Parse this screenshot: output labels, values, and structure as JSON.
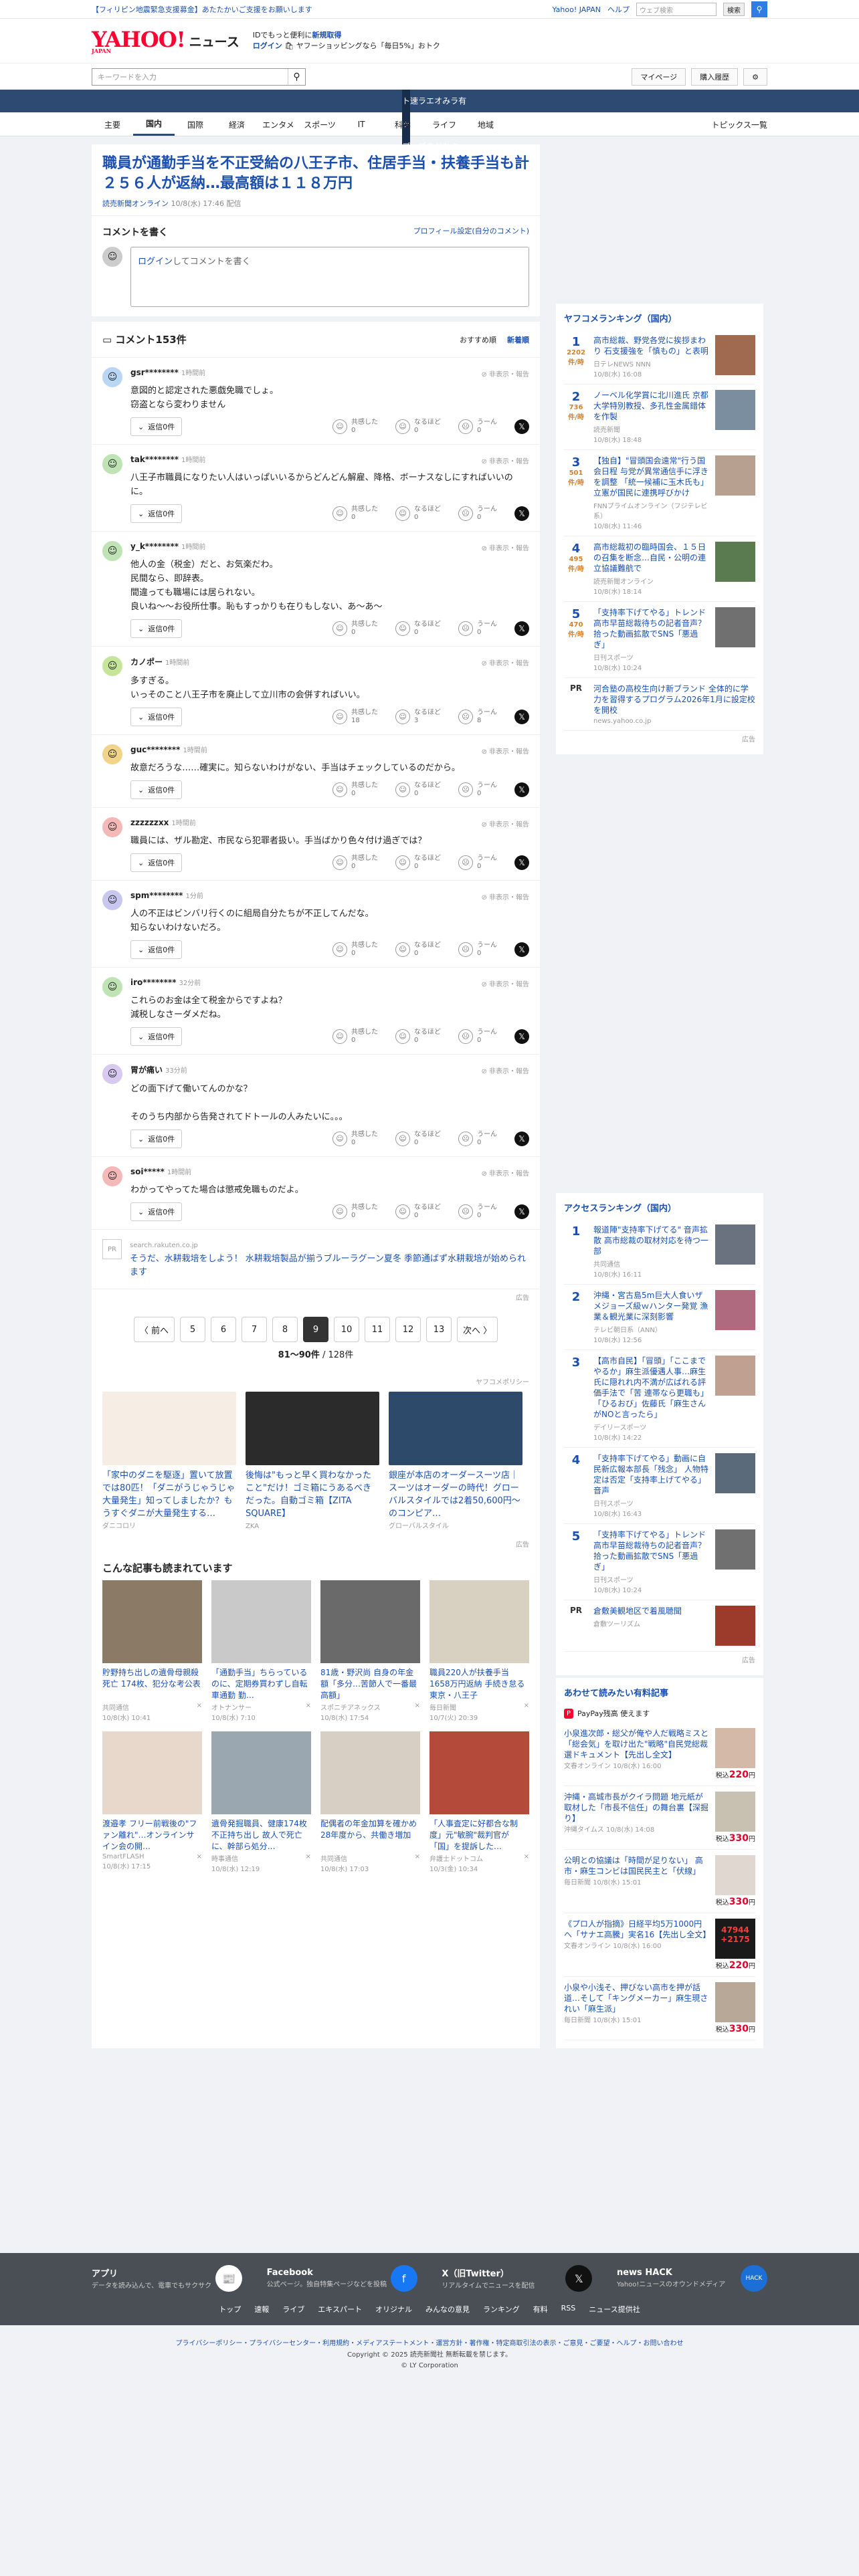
{
  "top_bar": {
    "notice": "【フィリピン地震緊急支援募金】あたたかいご支援をお願いします",
    "yahoo_japan": "Yahoo! JAPAN",
    "help": "ヘルプ",
    "search_placeholder": "ウェブ検索",
    "search_button": "検索"
  },
  "header": {
    "logo": "YAHOO!",
    "logo_sub": "JAPAN",
    "logo_news": "ニュース",
    "promo1": "IDでもっと便利に",
    "promo1_link": "新規取得",
    "promo2_link": "ログイン",
    "promo2": "ヤフーショッピングなら「毎日5%」おトク",
    "search_placeholder": "キーワードを入力",
    "mypage": "マイページ",
    "history": "購入履歴"
  },
  "global_nav": [
    "トップ",
    "速報",
    "ライブ",
    "エキスパート",
    "オリジナル",
    "みんなの意見",
    "ランキング",
    "有料"
  ],
  "sub_nav": [
    "主要",
    "国内",
    "国際",
    "経済",
    "エンタメ",
    "スポーツ",
    "IT",
    "科学",
    "ライフ",
    "地域"
  ],
  "sub_nav_topics": "トピックス一覧",
  "article": {
    "title": "職員が通勤手当を不正受給の八王子市、住居手当・扶養手当も計２５６人が返納…最高額は１１８万円",
    "source": "読売新聞オンライン",
    "date": "10/8(水) 17:46 配信"
  },
  "comment_write": {
    "title": "コメントを書く",
    "profile_link": "プロフィール設定(自分のコメント)",
    "login": "ログイン",
    "placeholder": "してコメントを書く"
  },
  "comments_header": {
    "title": "コメント153件",
    "sort_recommended": "おすすめ順",
    "sort_newest": "新着順"
  },
  "comments": [
    {
      "user": "gsr********",
      "time": "1時間前",
      "text": "意図的と認定された悪戯免職でしょ。\n窃盗となら変わりません",
      "reply": "返信0件",
      "agree": "0",
      "nice": "0",
      "hmm": "0"
    },
    {
      "user": "tak********",
      "time": "1時間前",
      "text": "八王子市職員になりたい人はいっぱいいるからどんどん解雇、降格、ボーナスなしにすればいいのに。",
      "reply": "返信0件",
      "agree": "0",
      "nice": "0",
      "hmm": "0"
    },
    {
      "user": "y_k********",
      "time": "1時間前",
      "text": "他人の金（税金）だと、お気楽だわ。\n民間なら、即辞表。\n間違っても職場には居られない。\n良いね〜〜お役所仕事。恥もすっかりも在りもしない、あ〜あ〜",
      "reply": "返信0件",
      "agree": "0",
      "nice": "0",
      "hmm": "0"
    },
    {
      "user": "カノポー",
      "time": "1時間前",
      "text": "多すぎる。\nいっそのこと八王子市を廃止して立川市の会併すればいい。",
      "reply": "返信0件",
      "agree": "18",
      "nice": "3",
      "hmm": "8"
    },
    {
      "user": "guc********",
      "time": "1時間前",
      "text": "故意だろうな……確実に。知らないわけがない、手当はチェックしているのだから。",
      "reply": "返信0件",
      "agree": "0",
      "nice": "0",
      "hmm": "0"
    },
    {
      "user": "zzzzzzxx",
      "time": "1時間前",
      "text": "職員には、ザル勘定、市民なら犯罪者扱い。手当ばかり色々付け過ぎでは？",
      "reply": "返信0件",
      "agree": "0",
      "nice": "0",
      "hmm": "0"
    },
    {
      "user": "spm********",
      "time": "1分前",
      "text": "人の不正はビンバリ行くのに組局自分たちが不正してんだな。\n知らないわけないだろ。",
      "reply": "返信0件",
      "agree": "0",
      "nice": "0",
      "hmm": "0"
    },
    {
      "user": "iro********",
      "time": "32分前",
      "text": "これらのお金は全て税金からですよね？\n減税しなさーダメだね。",
      "reply": "返信0件",
      "agree": "0",
      "nice": "0",
      "hmm": "0"
    },
    {
      "user": "胃が痛い",
      "time": "33分前",
      "text": "どの面下げて働いてんのかな？\n\nそのうち内部から告発されてドトールの人みたいに。。。",
      "reply": "返信0件",
      "agree": "0",
      "nice": "0",
      "hmm": "0"
    },
    {
      "user": "soi*****",
      "time": "1時間前",
      "text": "わかってやってた場合は懲戒免職ものだよ。",
      "reply": "返信0件",
      "agree": "0",
      "nice": "0",
      "hmm": "0"
    }
  ],
  "hide_report": "非表示・報告",
  "vote_labels": {
    "agree": "共感した",
    "nice": "なるほど",
    "hmm": "うーん"
  },
  "pr_ad": {
    "source": "search.rakuten.co.jp",
    "text": "そうだ、水耕栽培をしよう！ 水耕栽培製品が揃うブルーラグーン夏冬 季節通ばず水耕栽培が始められます"
  },
  "ad_label": "広告",
  "pager": {
    "prev": "〈 前へ",
    "next": "次へ 〉",
    "pages": [
      "5",
      "6",
      "7",
      "8",
      "9",
      "10",
      "11",
      "12",
      "13"
    ],
    "current": "9",
    "count": "81〜90件",
    "total": "/ 128件"
  },
  "yahoo_ad_policy": "ヤフコメポリシー",
  "ads": [
    {
      "title": "「家中のダニを駆逐」置いて放置では80匹！「ダニがうじゃうじゃ大量発生」知ってしましたか？もうすぐダニが大量発生する…",
      "source": "ダニコロリ"
    },
    {
      "title": "後悔は\"もっと早く買わなかったこと\"だけ！ゴミ箱にうあるべきだった。自動ゴミ箱【ZITA SQUARE】",
      "source": "ZKA"
    },
    {
      "title": "銀座が本店のオーダースーツ店｜スーツはオーダーの時代！グローバルスタイルでは2着50,600円〜のコンピア…",
      "source": "グローバルスタイル"
    }
  ],
  "more_articles_title": "こんな記事も読まれています",
  "more_articles": [
    {
      "title": "貯野持ち出しの遺骨母親殺死亡 174枚、犯分な考公表",
      "src": "共同通信",
      "date": "10/8(水) 10:41"
    },
    {
      "title": "「通勤手当」ちらっているのに、定期券買わずし自転車通勤 勤…",
      "src": "オトナンサー",
      "date": "10/8(水) 7:10"
    },
    {
      "title": "81歳・野沢尚 自身の年金額「多分…苦節人で一番最高額」",
      "src": "スポニチアネックス",
      "date": "10/8(水) 17:54"
    },
    {
      "title": "職員220人が扶養手当1658万円返納 手続き怠る 東京・八王子",
      "src": "毎日新聞",
      "date": "10/7(火) 20:39"
    },
    {
      "title": "渡邉孝 フリー前戦後の\"ファン離れ\"…オンラインサイン会の開…",
      "src": "SmartFLASH",
      "date": "10/8(水) 17:15"
    },
    {
      "title": "遺骨発掘職員、健康174枚不正持ち出し 故人で死亡に、幹部ら処分…",
      "src": "時事通信",
      "date": "10/8(水) 12:19"
    },
    {
      "title": "配偶者の年金加算を確かめ 28年度から、共働き増加",
      "src": "共同通信",
      "date": "10/8(水) 17:03"
    },
    {
      "title": "「人事査定に好都合な制度」元\"敏腕\"裁判官が「国」を提訴した…",
      "src": "弁護士ドットコム",
      "date": "10/3(金) 10:34"
    }
  ],
  "ranking": {
    "title": "ヤフコメランキング（国内）",
    "items": [
      {
        "n": "1",
        "count": "2202",
        "unit": "件/時",
        "title": "高市総裁、野党各党に挨拶まわり 石支援強を「慎もの」と表明",
        "src": "日テレNEWS NNN",
        "date": "10/8(水) 16:08"
      },
      {
        "n": "2",
        "count": "736",
        "unit": "件/時",
        "title": "ノーベル化学賞に北川進氏 京都大学特別教授、多孔性金属錯体を作製",
        "src": "読売新聞",
        "date": "10/8(水) 18:48"
      },
      {
        "n": "3",
        "count": "501",
        "unit": "件/時",
        "title": "【独自】\"冒頭国会遠常\"行う国会日程 与党が異常通信手に浮きを調整 「統一候補に玉木氏も」立憲が国民に連携呼びかけ",
        "src": "FNNプライムオンライン（フジテレビ系）",
        "date": "10/8(水) 11:46"
      },
      {
        "n": "4",
        "count": "495",
        "unit": "件/時",
        "title": "高市総裁初の臨時国会、１５日の召集を断念…自民・公明の連立協議難航で",
        "src": "読売新聞オンライン",
        "date": "10/8(水) 18:14"
      },
      {
        "n": "5",
        "count": "470",
        "unit": "件/時",
        "title": "「支持率下げてやる」トレンド 高市早苗総裁待ちの記者音声？ 拾った動画拡散でSNS「悪過ぎ」",
        "src": "日刊スポーツ",
        "date": "10/8(水) 10:24"
      }
    ],
    "pr_title": "河合塾の高校生向け新ブランド 全体的に学力を習得するプログラム2026年1月に設定校を開校",
    "pr_src": "news.yahoo.co.jp"
  },
  "access_ranking": {
    "title": "アクセスランキング（国内）",
    "items": [
      {
        "n": "1",
        "title": "報道陣\"支持率下げてる\" 音声拡散 高市総裁の取材対応を待つ一部",
        "src": "共同通信",
        "date": "10/8(水) 16:11"
      },
      {
        "n": "2",
        "title": "沖縄・宮古島5m巨大人食いザメジョーズ級ｗハンター発覚 漁業＆観光業に深刻影響",
        "src": "テレビ朝日系（ANN）",
        "date": "10/8(水) 12:56"
      },
      {
        "n": "3",
        "title": "【高市自民】「冒頭」「ここまでやるか」麻生派優遇人事…麻生氏に隠れれ内不満が広ばれる評価手法で「苦 連帯なら更職も」「ひるおび」佐藤氏「麻生さんがNOと言ったら」",
        "src": "デイリースポーツ",
        "date": "10/8(水) 14:22"
      },
      {
        "n": "4",
        "title": "「支持率下げてやる」動画に自民新広報本部長「残念」 人物特定は否定「支持率上げてやる」音声",
        "src": "日刊スポーツ",
        "date": "10/8(水) 16:43"
      },
      {
        "n": "5",
        "title": "「支持率下げてやる」トレンド 高市早苗総裁待ちの記者音声？拾った動画拡散でSNS「悪過ぎ」",
        "src": "日刊スポーツ",
        "date": "10/8(水) 10:24"
      }
    ],
    "pr_title": "倉敷美観地区で着風聴聞",
    "pr_src": "倉敷ツーリズム"
  },
  "paid": {
    "title": "あわせて読みたい有料記事",
    "paypay": "PayPay残高 使えます",
    "items": [
      {
        "title": "小泉進次郎・総父が俺や人だ戦略ミスと「総会気」を取け出た\"戦略\"自民党総裁選ドキュメント【先出し全文】",
        "src": "文春オンライン",
        "date": "10/8(水) 16:00",
        "price": "220"
      },
      {
        "title": "沖縄・高城市長がクイラ問題 地元紙が取材した「市長不信任」の舞台裏【深掘り】",
        "src": "沖縄タイムス",
        "date": "10/8(水) 14:08",
        "price": "330"
      },
      {
        "title": "公明との協議は「時間が足りない」 高市・麻生コンビは国民民主と「伏線」",
        "src": "毎日新聞",
        "date": "10/8(水) 15:01",
        "price": "330"
      },
      {
        "title": "《プロ人が指摘》日経平均5万1000円へ「サナエ高騰」実名16【先出し全文】",
        "src": "文春オンライン",
        "date": "10/8(水) 16:00",
        "price": "220",
        "stock": "47944",
        "stock_delta": "+2175"
      },
      {
        "title": "小泉や小浅そ、押びない高市を押が話道…そして「キングメーカー」麻生現されい「麻生派」",
        "src": "毎日新聞",
        "date": "10/8(水) 15:01",
        "price": "330"
      }
    ],
    "price_prefix": "税込",
    "price_suffix": "円",
    "reward": "報酬ロ"
  },
  "footer": {
    "items": [
      {
        "name": "アプリ",
        "desc": "データを読み込んで、電車でもサクサク"
      },
      {
        "name": "Facebook",
        "desc": "公式ページ。独自特集ページなどを投稿"
      },
      {
        "name": "X（旧Twitter）",
        "desc": "リアルタイムでニュースを配信"
      },
      {
        "name": "news HACK",
        "desc": "Yahoo!ニュースのオウンドメディア"
      }
    ],
    "nav": [
      "トップ",
      "速報",
      "ライブ",
      "エキスパート",
      "オリジナル",
      "みんなの意見",
      "ランキング",
      "有料",
      "RSS",
      "ニュース提供社"
    ],
    "links": "プライバシーポリシー・プライバシーセンター・利用規約・メディアステートメント・運営方針・著作権・特定商取引法の表示・ご意見・ご要望・ヘルプ・お問い合わせ",
    "copyright1": "Copyright © 2025 読売新聞社 無断転載を禁じます。",
    "copyright2": "© LY Corporation"
  }
}
